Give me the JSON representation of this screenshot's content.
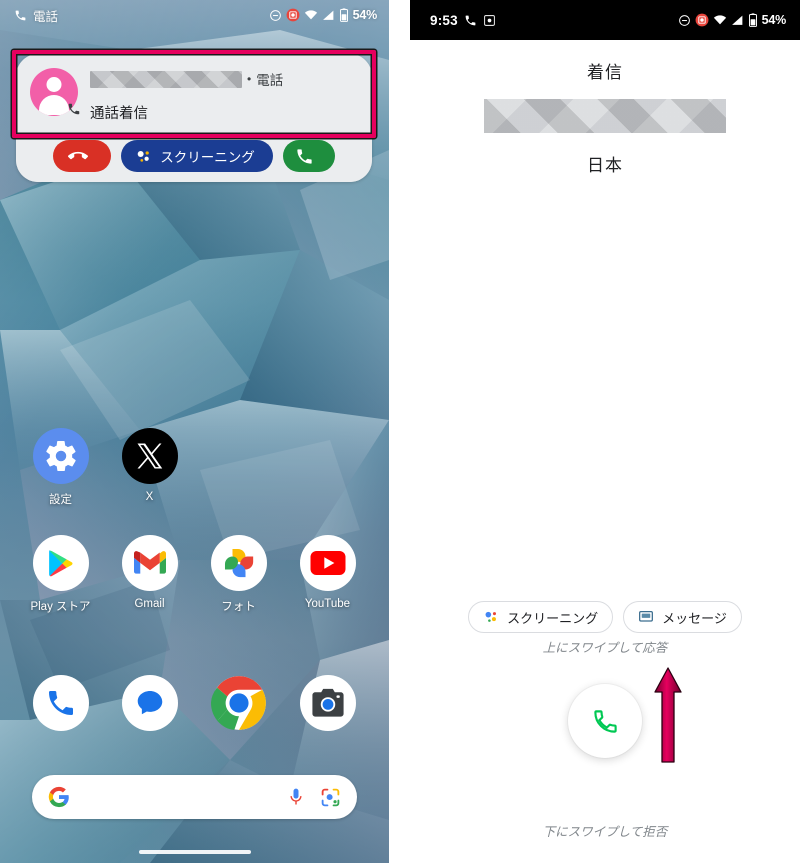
{
  "left_panel": {
    "status_bar": {
      "app_label": "電話",
      "phone_icon": "phone-icon",
      "dnd_icon": "do-not-disturb-icon",
      "record_icon": "screen-record-icon",
      "wifi_icon": "wifi-icon",
      "signal_icon": "cellular-signal-icon",
      "battery_icon": "battery-icon",
      "battery_percent": "54%"
    },
    "notification": {
      "caller_name_redacted": "",
      "separator": "•",
      "app_name": "電話",
      "title": "通話着信",
      "avatar_icon": "contact-avatar-icon",
      "avatar_badge_icon": "phone-icon",
      "actions": {
        "decline_label": "",
        "decline_icon": "call-end-icon",
        "screening_label": "スクリーニング",
        "screening_icon": "google-assistant-icon",
        "answer_label": "",
        "answer_icon": "phone-icon"
      }
    },
    "apps_row1": [
      {
        "label": "設定",
        "icon": "settings-gear-icon"
      },
      {
        "label": "X",
        "icon": "x-app-icon"
      }
    ],
    "apps_row2": [
      {
        "label": "Play ストア",
        "icon": "google-play-icon"
      },
      {
        "label": "Gmail",
        "icon": "gmail-icon"
      },
      {
        "label": "フォト",
        "icon": "google-photos-icon"
      },
      {
        "label": "YouTube",
        "icon": "youtube-icon"
      }
    ],
    "dock": [
      {
        "label": "電話",
        "icon": "phone-app-icon"
      },
      {
        "label": "メッセージ",
        "icon": "messages-app-icon"
      },
      {
        "label": "Chrome",
        "icon": "chrome-icon"
      },
      {
        "label": "カメラ",
        "icon": "camera-app-icon"
      }
    ],
    "search_bar": {
      "google_icon": "google-g-icon",
      "mic_icon": "microphone-icon",
      "lens_icon": "google-lens-icon",
      "value": ""
    },
    "nav_handle": "home-gesture-bar"
  },
  "right_panel": {
    "status_bar": {
      "time": "9:53",
      "phone_icon": "phone-icon",
      "record_icon": "screen-record-icon",
      "dnd_icon": "do-not-disturb-icon",
      "alert_icon": "recording-active-icon",
      "wifi_icon": "wifi-icon",
      "signal_icon": "cellular-signal-icon",
      "battery_icon": "battery-icon",
      "battery_percent": "54%"
    },
    "call": {
      "state_label": "着信",
      "caller_name_redacted": "",
      "caller_country": "日本",
      "screening_label": "スクリーニング",
      "screening_icon": "google-assistant-icon",
      "message_label": "メッセージ",
      "message_icon": "message-bubble-icon",
      "swipe_up_hint": "上にスワイプして応答",
      "swipe_down_hint": "下にスワイプして拒否",
      "answer_button_icon": "phone-icon"
    },
    "annotation": {
      "arrow_icon": "up-arrow-annotation",
      "color": "#e6005e"
    }
  },
  "colors": {
    "annotation_pink": "#e6005e",
    "decline_red": "#d93025",
    "answer_green": "#1e8e3e",
    "screening_blue": "#1b3d93",
    "status_black": "#000000"
  }
}
